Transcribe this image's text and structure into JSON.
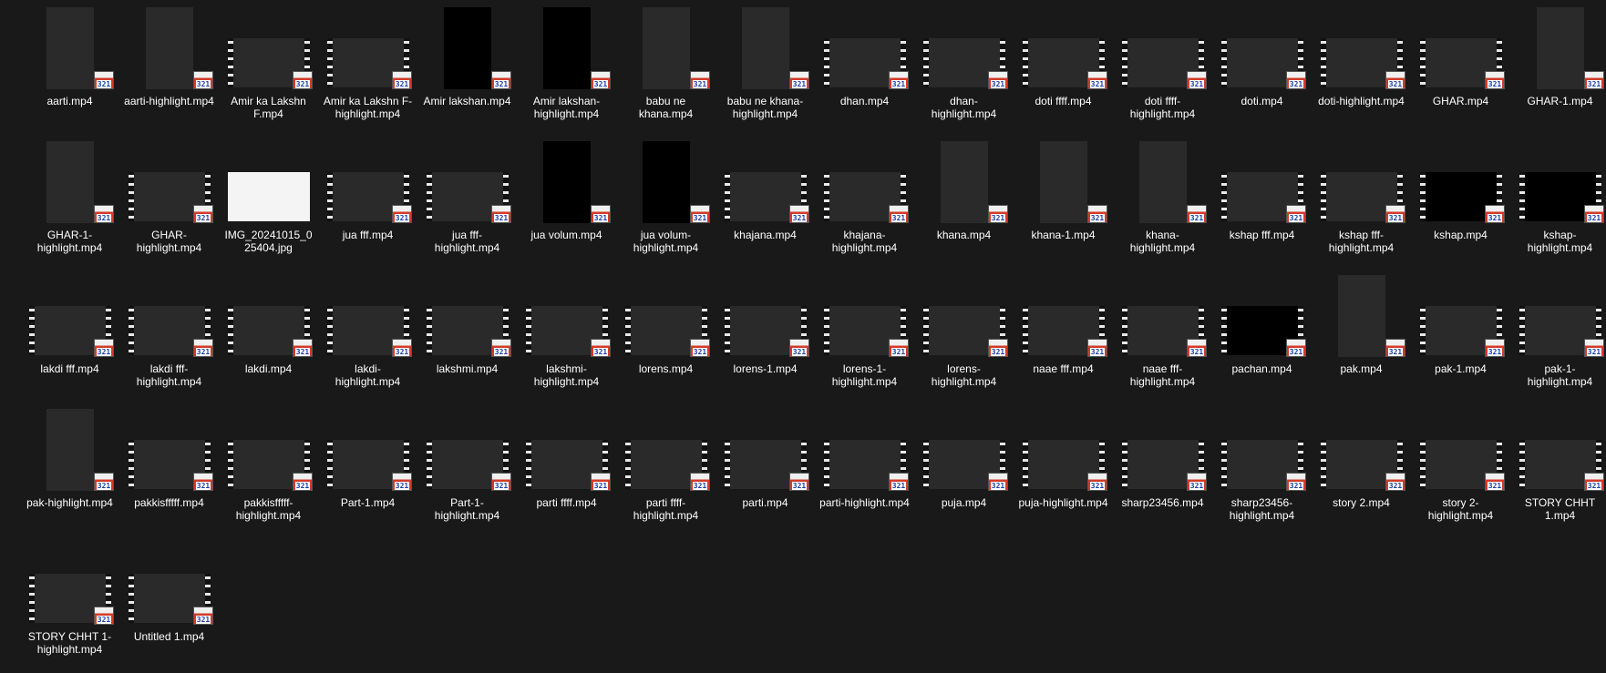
{
  "badge_text": "321",
  "items": [
    {
      "name": "aarti.mp4",
      "shape": "port",
      "bg": "#c9b9a8",
      "fg": "#d95a7a"
    },
    {
      "name": "aarti-highlight.mp4",
      "shape": "port",
      "bg": "#c4b6a6",
      "fg": "#e06a84"
    },
    {
      "name": "Amir ka Lakshn F.mp4",
      "shape": "land",
      "bg": "#d8d8d8",
      "fg": "#4a5a6a"
    },
    {
      "name": "Amir ka Lakshn F-highlight.mp4",
      "shape": "land",
      "bg": "#d4d4d4",
      "fg": "#3e5266"
    },
    {
      "name": "Amir lakshan.mp4",
      "shape": "port",
      "bg": "#000000",
      "fg": "#000000"
    },
    {
      "name": "Amir lakshan-highlight.mp4",
      "shape": "port",
      "bg": "#000000",
      "fg": "#000000"
    },
    {
      "name": "babu ne khana.mp4",
      "shape": "port",
      "bg": "#c7b8a6",
      "fg": "#7a5a40"
    },
    {
      "name": "babu ne khana-highlight.mp4",
      "shape": "port",
      "bg": "#c8bba8",
      "fg": "#6a4e36"
    },
    {
      "name": "dhan.mp4",
      "shape": "land",
      "bg": "#e8e0d8",
      "fg": "#c05030"
    },
    {
      "name": "dhan-highlight.mp4",
      "shape": "land",
      "bg": "#c9c0a8",
      "fg": "#e0a030"
    },
    {
      "name": "doti ffff.mp4",
      "shape": "land",
      "bg": "#2b4fd0",
      "fg": "#d04050"
    },
    {
      "name": "doti ffff-highlight.mp4",
      "shape": "land",
      "bg": "#2b4fd0",
      "fg": "#d04050"
    },
    {
      "name": "doti.mp4",
      "shape": "land",
      "bg": "#0a0a0a",
      "fg": "#c85060"
    },
    {
      "name": "doti-highlight.mp4",
      "shape": "land",
      "bg": "#0a0a0a",
      "fg": "#c85060"
    },
    {
      "name": "GHAR.mp4",
      "shape": "land",
      "bg": "#d8c0c0",
      "fg": "#a88080"
    },
    {
      "name": "GHAR-1.mp4",
      "shape": "port",
      "bg": "#b07070",
      "fg": "#5080c0"
    },
    {
      "name": "GHAR-1-highlight.mp4",
      "shape": "port",
      "bg": "#a08090",
      "fg": "#c09090"
    },
    {
      "name": "GHAR-highlight.mp4",
      "shape": "land",
      "bg": "#4a5048",
      "fg": "#7a8070"
    },
    {
      "name": "IMG_20241015_025404.jpg",
      "shape": "jpg",
      "bg": "#f4f4f4",
      "fg": "#c03030"
    },
    {
      "name": "jua fff.mp4",
      "shape": "land",
      "bg": "#6050a0",
      "fg": "#d0c0e0"
    },
    {
      "name": "jua fff-highlight.mp4",
      "shape": "land",
      "bg": "#303040",
      "fg": "#8090b0"
    },
    {
      "name": "jua volum.mp4",
      "shape": "port",
      "bg": "#000000",
      "fg": "#000000"
    },
    {
      "name": "jua volum-highlight.mp4",
      "shape": "port",
      "bg": "#000000",
      "fg": "#000000"
    },
    {
      "name": "khajana.mp4",
      "shape": "land",
      "bg": "#0a0a0a",
      "fg": "#c85060"
    },
    {
      "name": "khajana-highlight.mp4",
      "shape": "land",
      "bg": "#0a0a0a",
      "fg": "#c85060"
    },
    {
      "name": "khana.mp4",
      "shape": "port",
      "bg": "#c0b098",
      "fg": "#705030"
    },
    {
      "name": "khana-1.mp4",
      "shape": "port",
      "bg": "#c8b8a0",
      "fg": "#806040"
    },
    {
      "name": "khana-highlight.mp4",
      "shape": "port",
      "bg": "#a08090",
      "fg": "#c09090"
    },
    {
      "name": "kshap fff.mp4",
      "shape": "land",
      "bg": "#6a5a40",
      "fg": "#a08858"
    },
    {
      "name": "kshap fff-highlight.mp4",
      "shape": "land",
      "bg": "#5a8a50",
      "fg": "#a07040"
    },
    {
      "name": "kshap.mp4",
      "shape": "land",
      "bg": "#000000",
      "fg": "#000000"
    },
    {
      "name": "kshap-highlight.mp4",
      "shape": "land",
      "bg": "#000000",
      "fg": "#000000"
    },
    {
      "name": "lakdi fff.mp4",
      "shape": "land",
      "bg": "#0a0a0a",
      "fg": "#7090c0"
    },
    {
      "name": "lakdi fff-highlight.mp4",
      "shape": "land",
      "bg": "#0a0a0a",
      "fg": "#7090c0"
    },
    {
      "name": "lakdi.mp4",
      "shape": "land",
      "bg": "#0a0a0a",
      "fg": "#7090c0"
    },
    {
      "name": "lakdi-highlight.mp4",
      "shape": "land",
      "bg": "#0a0a0a",
      "fg": "#7090c0"
    },
    {
      "name": "lakshmi.mp4",
      "shape": "land",
      "bg": "#5a3030",
      "fg": "#c08060"
    },
    {
      "name": "lakshmi-highlight.mp4",
      "shape": "land",
      "bg": "#204850",
      "fg": "#305858"
    },
    {
      "name": "lorens.mp4",
      "shape": "land",
      "bg": "#201810",
      "fg": "#c8a070"
    },
    {
      "name": "lorens-1.mp4",
      "shape": "land",
      "bg": "#506070",
      "fg": "#303840"
    },
    {
      "name": "lorens-1-highlight.mp4",
      "shape": "land",
      "bg": "#708090",
      "fg": "#404850"
    },
    {
      "name": "lorens-highlight.mp4",
      "shape": "land",
      "bg": "#181818",
      "fg": "#a08070"
    },
    {
      "name": "naae fff.mp4",
      "shape": "land",
      "bg": "#0a0a0a",
      "fg": "#7090c0"
    },
    {
      "name": "naae fff-highlight.mp4",
      "shape": "land",
      "bg": "#0a0a0a",
      "fg": "#7090c0"
    },
    {
      "name": "pachan.mp4",
      "shape": "land",
      "bg": "#000000",
      "fg": "#000000"
    },
    {
      "name": "pak.mp4",
      "shape": "port",
      "bg": "#8a8a90",
      "fg": "#505060"
    },
    {
      "name": "pak-1.mp4",
      "shape": "land",
      "bg": "#0a0a0a",
      "fg": "#d09040"
    },
    {
      "name": "pak-1-highlight.mp4",
      "shape": "land",
      "bg": "#0a0a0a",
      "fg": "#d09040"
    },
    {
      "name": "pak-highlight.mp4",
      "shape": "port",
      "bg": "#8a8a90",
      "fg": "#303848"
    },
    {
      "name": "pakkisfffff.mp4",
      "shape": "land",
      "bg": "#0a0a0a",
      "fg": "#d09040"
    },
    {
      "name": "pakkisfffff-highlight.mp4",
      "shape": "land",
      "bg": "#102030",
      "fg": "#4060a0"
    },
    {
      "name": "Part-1.mp4",
      "shape": "land",
      "bg": "#4a3020",
      "fg": "#a07050"
    },
    {
      "name": "Part-1-highlight.mp4",
      "shape": "land",
      "bg": "#d0a070",
      "fg": "#c04040"
    },
    {
      "name": "parti ffff.mp4",
      "shape": "land",
      "bg": "#e0c090",
      "fg": "#c05030"
    },
    {
      "name": "parti ffff-highlight.mp4",
      "shape": "land",
      "bg": "#f0f0f0",
      "fg": "#e04030"
    },
    {
      "name": "parti.mp4",
      "shape": "land",
      "bg": "#f0f0f0",
      "fg": "#e08030"
    },
    {
      "name": "parti-highlight.mp4",
      "shape": "land",
      "bg": "#f0f0f0",
      "fg": "#e04030"
    },
    {
      "name": "puja.mp4",
      "shape": "land",
      "bg": "#707880",
      "fg": "#a08060"
    },
    {
      "name": "puja-highlight.mp4",
      "shape": "land",
      "bg": "#686058",
      "fg": "#908070"
    },
    {
      "name": "sharp23456.mp4",
      "shape": "land",
      "bg": "#6a5a40",
      "fg": "#a08858"
    },
    {
      "name": "sharp23456-highlight.mp4",
      "shape": "land",
      "bg": "#5a8a50",
      "fg": "#a07040"
    },
    {
      "name": "story 2.mp4",
      "shape": "land",
      "bg": "#3050a0",
      "fg": "#d0d0d8"
    },
    {
      "name": "story 2-highlight.mp4",
      "shape": "land",
      "bg": "#5a7050",
      "fg": "#c09070"
    },
    {
      "name": "STORY CHHT 1.mp4",
      "shape": "land",
      "bg": "#6070a0",
      "fg": "#c04040"
    },
    {
      "name": "STORY CHHT 1-highlight.mp4",
      "shape": "land",
      "bg": "#6070a0",
      "fg": "#c06040"
    },
    {
      "name": "Untitled 1.mp4",
      "shape": "land",
      "bg": "#707070",
      "fg": "#d08040"
    }
  ]
}
